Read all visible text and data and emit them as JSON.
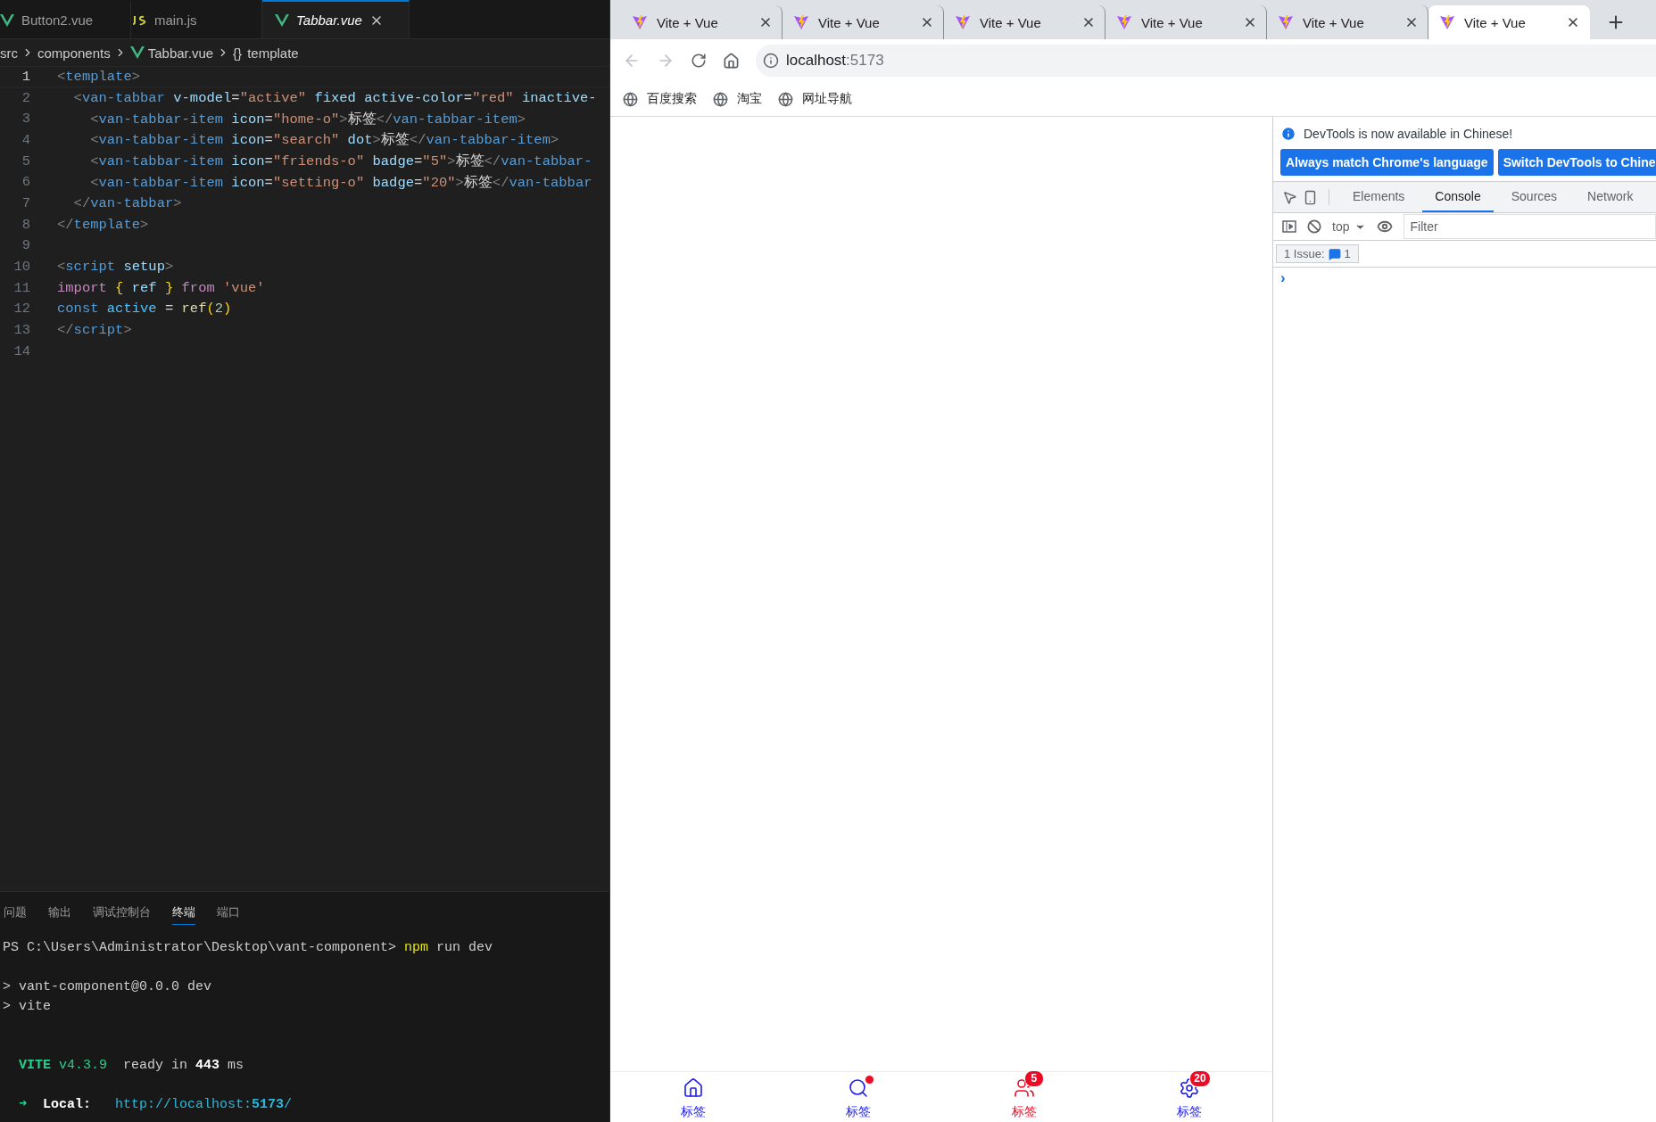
{
  "editor": {
    "tabs": [
      {
        "label": "Button2.vue",
        "kind": "vue",
        "selected": false
      },
      {
        "label": "main.js",
        "kind": "js",
        "selected": false
      },
      {
        "label": "Tabbar.vue",
        "kind": "vue",
        "selected": true
      }
    ],
    "breadcrumb": [
      {
        "text": "src",
        "kind": "plain"
      },
      {
        "text": "components",
        "kind": "plain"
      },
      {
        "text": "Tabbar.vue",
        "kind": "vue"
      },
      {
        "text": "{}",
        "kind": "symbol"
      },
      {
        "text": "template",
        "kind": "plain"
      }
    ],
    "lines": [
      {
        "number": "1",
        "current": true,
        "tokens": [
          {
            "text": "<",
            "kind": "punct"
          },
          {
            "text": "template",
            "kind": "tag"
          },
          {
            "text": ">",
            "kind": "punct"
          }
        ]
      },
      {
        "number": "2",
        "current": false,
        "tokens": [
          {
            "text": "  <",
            "kind": "punct"
          },
          {
            "text": "van-tabbar",
            "kind": "tag"
          },
          {
            "text": " v-model",
            "kind": "attr"
          },
          {
            "text": "=",
            "kind": "text"
          },
          {
            "text": "\"active\"",
            "kind": "string"
          },
          {
            "text": " fixed active-color",
            "kind": "attr"
          },
          {
            "text": "=",
            "kind": "text"
          },
          {
            "text": "\"red\"",
            "kind": "string"
          },
          {
            "text": " inactive-",
            "kind": "attr"
          }
        ]
      },
      {
        "number": "3",
        "current": false,
        "tokens": [
          {
            "text": "    <",
            "kind": "punct"
          },
          {
            "text": "van-tabbar-item",
            "kind": "tag"
          },
          {
            "text": " icon",
            "kind": "attr"
          },
          {
            "text": "=",
            "kind": "text"
          },
          {
            "text": "\"home-o\"",
            "kind": "string"
          },
          {
            "text": ">",
            "kind": "punct"
          },
          {
            "text": "标签",
            "kind": "text"
          },
          {
            "text": "</",
            "kind": "punct"
          },
          {
            "text": "van-tabbar-item",
            "kind": "tag"
          },
          {
            "text": ">",
            "kind": "punct"
          }
        ]
      },
      {
        "number": "4",
        "current": false,
        "tokens": [
          {
            "text": "    <",
            "kind": "punct"
          },
          {
            "text": "van-tabbar-item",
            "kind": "tag"
          },
          {
            "text": " icon",
            "kind": "attr"
          },
          {
            "text": "=",
            "kind": "text"
          },
          {
            "text": "\"search\"",
            "kind": "string"
          },
          {
            "text": " dot",
            "kind": "attr"
          },
          {
            "text": ">",
            "kind": "punct"
          },
          {
            "text": "标签",
            "kind": "text"
          },
          {
            "text": "</",
            "kind": "punct"
          },
          {
            "text": "van-tabbar-item",
            "kind": "tag"
          },
          {
            "text": ">",
            "kind": "punct"
          }
        ]
      },
      {
        "number": "5",
        "current": false,
        "tokens": [
          {
            "text": "    <",
            "kind": "punct"
          },
          {
            "text": "van-tabbar-item",
            "kind": "tag"
          },
          {
            "text": " icon",
            "kind": "attr"
          },
          {
            "text": "=",
            "kind": "text"
          },
          {
            "text": "\"friends-o\"",
            "kind": "string"
          },
          {
            "text": " badge",
            "kind": "attr"
          },
          {
            "text": "=",
            "kind": "text"
          },
          {
            "text": "\"5\"",
            "kind": "string"
          },
          {
            "text": ">",
            "kind": "punct"
          },
          {
            "text": "标签",
            "kind": "text"
          },
          {
            "text": "</",
            "kind": "punct"
          },
          {
            "text": "van-tabbar-",
            "kind": "tag"
          }
        ]
      },
      {
        "number": "6",
        "current": false,
        "tokens": [
          {
            "text": "    <",
            "kind": "punct"
          },
          {
            "text": "van-tabbar-item",
            "kind": "tag"
          },
          {
            "text": " icon",
            "kind": "attr"
          },
          {
            "text": "=",
            "kind": "text"
          },
          {
            "text": "\"setting-o\"",
            "kind": "string"
          },
          {
            "text": " badge",
            "kind": "attr"
          },
          {
            "text": "=",
            "kind": "text"
          },
          {
            "text": "\"20\"",
            "kind": "string"
          },
          {
            "text": ">",
            "kind": "punct"
          },
          {
            "text": "标签",
            "kind": "text"
          },
          {
            "text": "</",
            "kind": "punct"
          },
          {
            "text": "van-tabbar",
            "kind": "tag"
          }
        ]
      },
      {
        "number": "7",
        "current": false,
        "tokens": [
          {
            "text": "  </",
            "kind": "punct"
          },
          {
            "text": "van-tabbar",
            "kind": "tag"
          },
          {
            "text": ">",
            "kind": "punct"
          }
        ]
      },
      {
        "number": "8",
        "current": false,
        "tokens": [
          {
            "text": "</",
            "kind": "punct"
          },
          {
            "text": "template",
            "kind": "tag"
          },
          {
            "text": ">",
            "kind": "punct"
          }
        ]
      },
      {
        "number": "9",
        "current": false
      },
      {
        "number": "10",
        "current": false,
        "tokens": [
          {
            "text": "<",
            "kind": "punct"
          },
          {
            "text": "script",
            "kind": "tag"
          },
          {
            "text": " setup",
            "kind": "attr"
          },
          {
            "text": ">",
            "kind": "punct"
          }
        ]
      },
      {
        "number": "11",
        "current": false,
        "tokens": [
          {
            "text": "import",
            "kind": "keyword"
          },
          {
            "text": " {",
            "kind": "brace"
          },
          {
            "text": " ref ",
            "kind": "ident"
          },
          {
            "text": "}",
            "kind": "brace"
          },
          {
            "text": " from",
            "kind": "keyword"
          },
          {
            "text": " 'vue'",
            "kind": "string"
          }
        ]
      },
      {
        "number": "12",
        "current": false,
        "tokens": [
          {
            "text": "const",
            "kind": "const"
          },
          {
            "text": " active",
            "kind": "constname"
          },
          {
            "text": " = ",
            "kind": "text"
          },
          {
            "text": "ref",
            "kind": "func"
          },
          {
            "text": "(",
            "kind": "brace"
          },
          {
            "text": "2",
            "kind": "number"
          },
          {
            "text": ")",
            "kind": "brace"
          }
        ]
      },
      {
        "number": "13",
        "current": false,
        "tokens": [
          {
            "text": "</",
            "kind": "punct"
          },
          {
            "text": "script",
            "kind": "tag"
          },
          {
            "text": ">",
            "kind": "punct"
          }
        ]
      },
      {
        "number": "14",
        "current": false
      }
    ]
  },
  "panel": {
    "tabs": [
      {
        "label": "问题",
        "selected": false
      },
      {
        "label": "输出",
        "selected": false
      },
      {
        "label": "调试控制台",
        "selected": false
      },
      {
        "label": "终端",
        "selected": true
      },
      {
        "label": "端口",
        "selected": false
      }
    ],
    "blocks": [
      {
        "kind": "command",
        "lines": [
          [
            {
              "text": "PS C:\\Users\\Administrator\\Desktop\\vant-component> ",
              "kind": "text"
            },
            {
              "text": "npm",
              "kind": "command"
            },
            {
              "text": " run dev",
              "kind": "text"
            }
          ]
        ]
      },
      {
        "kind": "output",
        "lines": [
          [
            {
              "text": "> vant-component@0.0.0 dev",
              "kind": "text"
            }
          ],
          [
            {
              "text": "> vite",
              "kind": "text"
            }
          ]
        ]
      },
      {
        "kind": "banner",
        "lines": [
          [
            {
              "text": "  VITE",
              "kind": "brand"
            },
            {
              "text": " v4.3.9",
              "kind": "version"
            },
            {
              "text": "  ready in ",
              "kind": "text"
            },
            {
              "text": "443",
              "kind": "strong"
            },
            {
              "text": " ms",
              "kind": "text"
            }
          ]
        ]
      },
      {
        "kind": "output",
        "lines": [
          [
            {
              "text": "  ➜  ",
              "kind": "version"
            },
            {
              "text": "Local:   ",
              "kind": "strong"
            },
            {
              "text": "http://localhost:",
              "kind": "link"
            },
            {
              "text": "5173",
              "kind": "linkstrong"
            },
            {
              "text": "/",
              "kind": "link"
            }
          ]
        ]
      }
    ]
  },
  "browser": {
    "tabs": [
      {
        "title": "Vite + Vue",
        "selected": false
      },
      {
        "title": "Vite + Vue",
        "selected": false
      },
      {
        "title": "Vite + Vue",
        "selected": false
      },
      {
        "title": "Vite + Vue",
        "selected": false
      },
      {
        "title": "Vite + Vue",
        "selected": false
      },
      {
        "title": "Vite + Vue",
        "selected": true
      }
    ],
    "address": {
      "host": "localhost",
      "port": ":5173"
    },
    "bookmarks": [
      "百度搜索",
      "淘宝",
      "网址导航"
    ]
  },
  "tabbar": {
    "items": [
      {
        "kind": "home",
        "label": "标签",
        "selected": false,
        "dot": false
      },
      {
        "kind": "search",
        "label": "标签",
        "selected": false,
        "dot": true
      },
      {
        "kind": "friends",
        "label": "标签",
        "selected": true,
        "dot": false,
        "badge": "5"
      },
      {
        "kind": "setting",
        "label": "标签",
        "selected": false,
        "dot": false,
        "badge": "20"
      }
    ]
  },
  "devtools": {
    "notice": "DevTools is now available in Chinese!",
    "buttons": [
      "Always match Chrome's language",
      "Switch DevTools to Chine"
    ],
    "tabs": [
      {
        "label": "Elements",
        "selected": false
      },
      {
        "label": "Console",
        "selected": true
      },
      {
        "label": "Sources",
        "selected": false
      },
      {
        "label": "Network",
        "selected": false
      }
    ],
    "context": "top",
    "filter_placeholder": "Filter",
    "issues": {
      "label": "1 Issue:",
      "count": "1"
    },
    "prompt": "›"
  }
}
